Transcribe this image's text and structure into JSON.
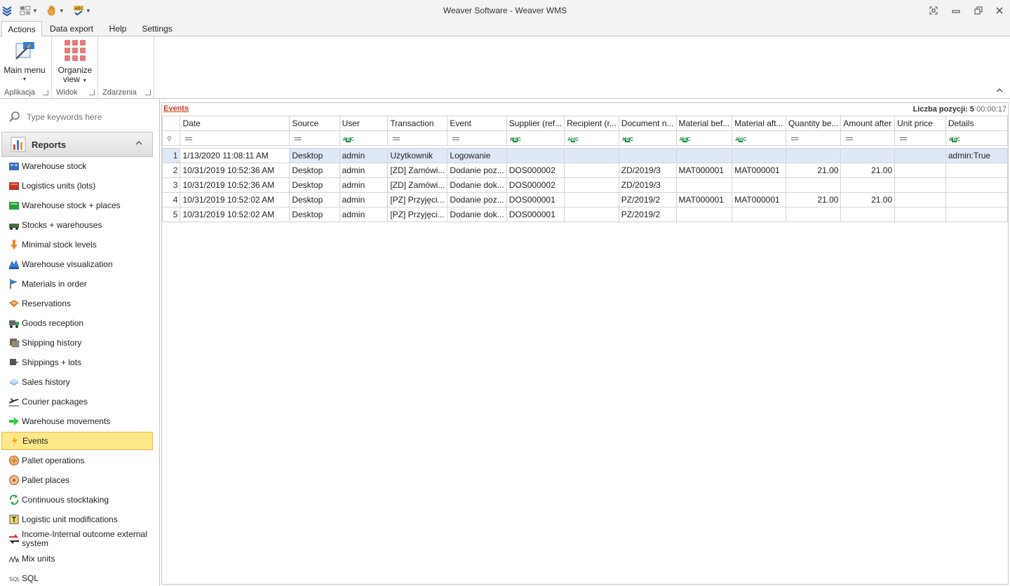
{
  "window": {
    "title": "Weaver Software - Weaver WMS"
  },
  "tabs": [
    {
      "label": "Actions",
      "active": true
    },
    {
      "label": "Data export",
      "active": false
    },
    {
      "label": "Help",
      "active": false
    },
    {
      "label": "Settings",
      "active": false
    }
  ],
  "ribbon": {
    "groups": [
      {
        "label": "Aplikacja",
        "buttons": [
          {
            "label1": "Main menu",
            "label2": ""
          }
        ]
      },
      {
        "label": "Widok",
        "buttons": [
          {
            "label1": "Organize",
            "label2": "view"
          }
        ]
      },
      {
        "label": "Zdarzenia",
        "buttons": []
      }
    ]
  },
  "sidebar": {
    "search_placeholder": "Type keywords here",
    "group_label": "Reports",
    "items": [
      {
        "label": "Warehouse stock",
        "icon": "warehouse-stock-icon",
        "active": false
      },
      {
        "label": "Logistics units (lots)",
        "icon": "logistics-units-icon",
        "active": false
      },
      {
        "label": "Warehouse stock + places",
        "icon": "stock-places-icon",
        "active": false
      },
      {
        "label": "Stocks + warehouses",
        "icon": "stocks-warehouses-icon",
        "active": false
      },
      {
        "label": "Minimal stock levels",
        "icon": "arrow-down-icon",
        "active": false
      },
      {
        "label": "Warehouse visualization",
        "icon": "warehouse-visualization-icon",
        "active": false
      },
      {
        "label": "Materials in order",
        "icon": "flag-icon",
        "active": false
      },
      {
        "label": "Reservations",
        "icon": "reservations-icon",
        "active": false
      },
      {
        "label": "Goods reception",
        "icon": "truck-icon",
        "active": false
      },
      {
        "label": "Shipping history",
        "icon": "shipping-history-icon",
        "active": false
      },
      {
        "label": "Shippings + lots",
        "icon": "shipping-lots-icon",
        "active": false
      },
      {
        "label": "Sales history",
        "icon": "sales-history-icon",
        "active": false
      },
      {
        "label": "Courier packages",
        "icon": "plane-icon",
        "active": false
      },
      {
        "label": "Warehouse movements",
        "icon": "arrow-right-icon",
        "active": false
      },
      {
        "label": "Events",
        "icon": "lightning-icon",
        "active": true
      },
      {
        "label": "Pallet operations",
        "icon": "pallet-operations-icon",
        "active": false
      },
      {
        "label": "Pallet places",
        "icon": "pallet-places-icon",
        "active": false
      },
      {
        "label": "Continuous stocktaking",
        "icon": "refresh-icon",
        "active": false
      },
      {
        "label": "Logistic unit modifications",
        "icon": "unit-modifications-icon",
        "active": false
      },
      {
        "label": "Income-Internal outcome external system",
        "icon": "exchange-icon",
        "active": false
      },
      {
        "label": "Mix units",
        "icon": "mix-units-icon",
        "active": false
      },
      {
        "label": "SQL",
        "icon": "sql-icon",
        "active": false
      }
    ]
  },
  "panel": {
    "title": "Events",
    "count_label": "Liczba pozycji: 5",
    "timer": "00:00:17"
  },
  "grid": {
    "columns": [
      {
        "label": "Date",
        "filter": "eq"
      },
      {
        "label": "Source",
        "filter": "eq"
      },
      {
        "label": "User",
        "filter": "abc"
      },
      {
        "label": "Transaction",
        "filter": "eq"
      },
      {
        "label": "Event",
        "filter": "eq"
      },
      {
        "label": "Supplier (ref...",
        "filter": "abc"
      },
      {
        "label": "Recipient (r...",
        "filter": "abc"
      },
      {
        "label": "Document n...",
        "filter": "abc"
      },
      {
        "label": "Material bef...",
        "filter": "abc"
      },
      {
        "label": "Material aft...",
        "filter": "abc"
      },
      {
        "label": "Quantity be...",
        "filter": "eq"
      },
      {
        "label": "Amount after",
        "filter": "eq"
      },
      {
        "label": "Unit price",
        "filter": "eq"
      },
      {
        "label": "Details",
        "filter": "abc"
      }
    ],
    "rows": [
      {
        "n": "1",
        "selected": true,
        "cells": [
          "1/13/2020 11:08:11 AM",
          "Desktop",
          "admin",
          "Użytkownik",
          "Logowanie",
          "",
          "",
          "",
          "",
          "",
          "",
          "",
          "",
          "admin:True"
        ]
      },
      {
        "n": "2",
        "selected": false,
        "cells": [
          "10/31/2019 10:52:36 AM",
          "Desktop",
          "admin",
          "[ZD] Zamówi...",
          "Dodanie poz...",
          "DOS000002",
          "",
          "ZD/2019/3",
          "MAT000001",
          "MAT000001",
          "21.00",
          "21.00",
          "",
          ""
        ]
      },
      {
        "n": "3",
        "selected": false,
        "cells": [
          "10/31/2019 10:52:36 AM",
          "Desktop",
          "admin",
          "[ZD] Zamówi...",
          "Dodanie dok...",
          "DOS000002",
          "",
          "ZD/2019/3",
          "",
          "",
          "",
          "",
          "",
          ""
        ]
      },
      {
        "n": "4",
        "selected": false,
        "cells": [
          "10/31/2019 10:52:02 AM",
          "Desktop",
          "admin",
          "[PZ] Przyjęci...",
          "Dodanie poz...",
          "DOS000001",
          "",
          "PZ/2019/2",
          "MAT000001",
          "MAT000001",
          "21.00",
          "21.00",
          "",
          ""
        ]
      },
      {
        "n": "5",
        "selected": false,
        "cells": [
          "10/31/2019 10:52:02 AM",
          "Desktop",
          "admin",
          "[PZ] Przyjęci...",
          "Dodanie dok...",
          "DOS000001",
          "",
          "PZ/2019/2",
          "",
          "",
          "",
          "",
          "",
          ""
        ]
      }
    ]
  }
}
